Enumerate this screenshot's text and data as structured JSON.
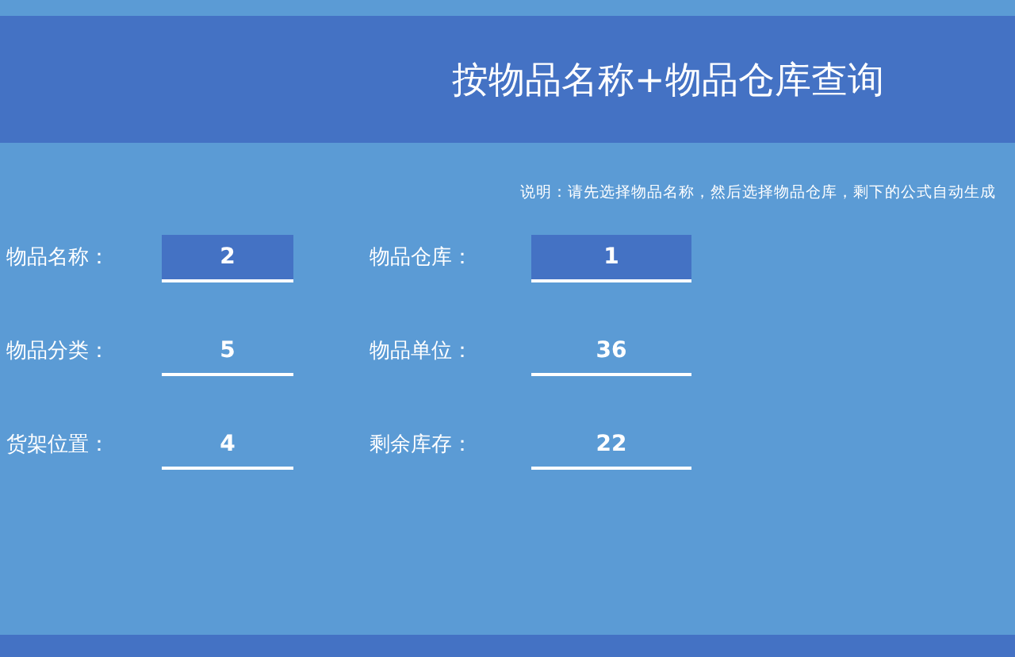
{
  "title": "按物品名称+物品仓库查询",
  "note": "说明：请先选择物品名称，然后选择物品仓库，剩下的公式自动生成",
  "rows": [
    [
      {
        "label": "物品名称：",
        "value": "2",
        "kind": "input"
      },
      {
        "label": "物品仓库：",
        "value": "1",
        "kind": "input"
      }
    ],
    [
      {
        "label": "物品分类：",
        "value": "5",
        "kind": "output"
      },
      {
        "label": "物品单位：",
        "value": "36",
        "kind": "output"
      }
    ],
    [
      {
        "label": "货架位置：",
        "value": "4",
        "kind": "output"
      },
      {
        "label": "剩余库存：",
        "value": "22",
        "kind": "output"
      }
    ]
  ]
}
